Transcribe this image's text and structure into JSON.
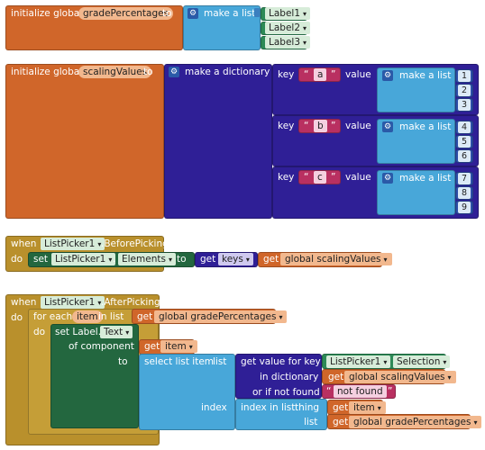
{
  "block1": {
    "init_label": "initialize global",
    "var_name": "gradePercentages",
    "to_label": "to",
    "make_list": "make a list",
    "items": [
      "Label1",
      "Label2",
      "Label3"
    ]
  },
  "block2": {
    "init_label": "initialize global",
    "var_name": "scalingValues",
    "to_label": "to",
    "make_dict": "make a dictionary",
    "key_label": "key",
    "value_label": "value",
    "make_list": "make a list",
    "keys": [
      "a",
      "b",
      "c"
    ],
    "values": [
      [
        "1",
        "2",
        "3"
      ],
      [
        "4",
        "5",
        "6"
      ],
      [
        "7",
        "8",
        "9"
      ]
    ]
  },
  "block3": {
    "when": "when",
    "component": "ListPicker1",
    "event": ".BeforePicking",
    "do": "do",
    "set": "set",
    "set_component": "ListPicker1",
    "dot": ".",
    "property": "Elements",
    "to": "to",
    "get": "get",
    "keys": "keys",
    "global_var": "global scalingValues"
  },
  "block4": {
    "when": "when",
    "component": "ListPicker1",
    "event": ".AfterPicking",
    "do": "do",
    "for_each": "for each",
    "item": "item",
    "in_list": "in list",
    "get": "get",
    "global_grade": "global gradePercentages",
    "inner_do": "do",
    "set_label": "set Label.",
    "text_prop": "Text",
    "of_component": "of component",
    "to": "to",
    "select_list_item": "select list item",
    "list": "list",
    "get_value_for_key": "get value for key",
    "selection_component": "ListPicker1",
    "selection": "Selection",
    "in_dictionary": "in dictionary",
    "global_scaling": "global scalingValues",
    "if_not_found": "or if not found",
    "not_found": "not found",
    "index": "index",
    "index_in_list": "index in list",
    "thing": "thing"
  }
}
